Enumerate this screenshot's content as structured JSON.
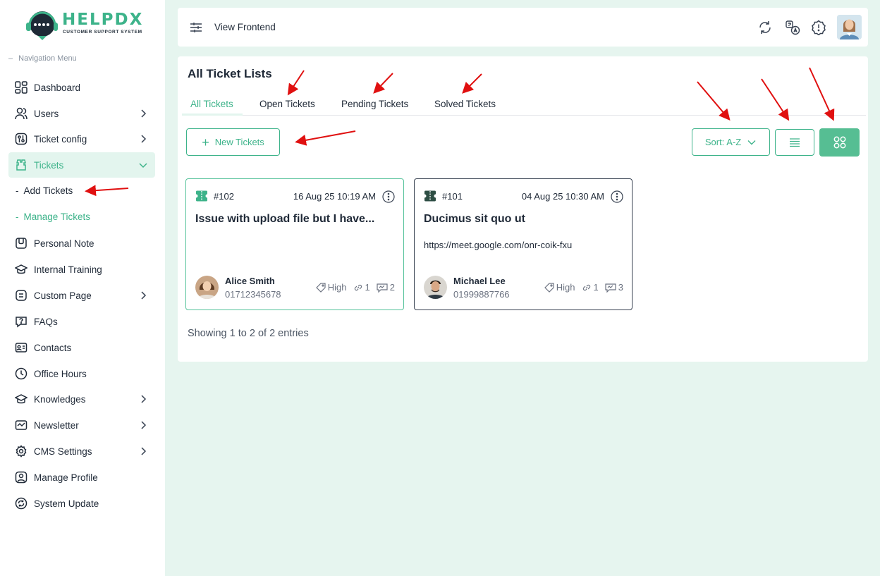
{
  "brand": {
    "name": "HELPDX",
    "tagline": "CUSTOMER SUPPORT SYSTEM",
    "color": "#3db38a"
  },
  "sidebar": {
    "heading": "Navigation Menu",
    "items": [
      {
        "label": "Dashboard",
        "icon": "dashboard-icon"
      },
      {
        "label": "Users",
        "icon": "users-icon"
      },
      {
        "label": "Ticket config",
        "icon": "ticket-config-icon"
      },
      {
        "label": "Tickets",
        "icon": "tickets-icon"
      },
      {
        "label": "Personal Note",
        "icon": "note-icon"
      },
      {
        "label": "Internal Training",
        "icon": "training-icon"
      },
      {
        "label": "Custom Page",
        "icon": "custom-page-icon"
      },
      {
        "label": "FAQs",
        "icon": "faq-icon"
      },
      {
        "label": "Contacts",
        "icon": "contacts-icon"
      },
      {
        "label": "Office Hours",
        "icon": "clock-icon"
      },
      {
        "label": "Knowledges",
        "icon": "knowledge-icon"
      },
      {
        "label": "Newsletter",
        "icon": "newsletter-icon"
      },
      {
        "label": "CMS Settings",
        "icon": "gear-icon"
      },
      {
        "label": "Manage Profile",
        "icon": "profile-icon"
      },
      {
        "label": "System Update",
        "icon": "update-icon"
      }
    ],
    "subitems": [
      {
        "label": "Add Tickets"
      },
      {
        "label": "Manage Tickets"
      }
    ]
  },
  "header": {
    "view_frontend": "View Frontend"
  },
  "main": {
    "title": "All Ticket Lists",
    "tabs": [
      {
        "label": "All Tickets"
      },
      {
        "label": "Open Tickets"
      },
      {
        "label": "Pending Tickets"
      },
      {
        "label": "Solved Tickets"
      }
    ],
    "new_button": "New Tickets",
    "sort_label": "Sort: A-Z",
    "showing": "Showing 1 to 2 of 2 entries"
  },
  "tickets": [
    {
      "id": "#102",
      "date": "16 Aug 25 10:19 AM",
      "title": "Issue with upload file but I have...",
      "description": "",
      "user_name": "Alice Smith",
      "user_phone": "01712345678",
      "priority": "High",
      "links": "1",
      "replies": "2"
    },
    {
      "id": "#101",
      "date": "04 Aug 25 10:30 AM",
      "title": "Ducimus sit quo ut",
      "description": "https://meet.google.com/onr-coik-fxu",
      "user_name": "Michael Lee",
      "user_phone": "01999887766",
      "priority": "High",
      "links": "1",
      "replies": "3"
    }
  ],
  "colors": {
    "accent": "#3db38a",
    "background": "#e6f5ef",
    "annotation": "#e01010"
  }
}
